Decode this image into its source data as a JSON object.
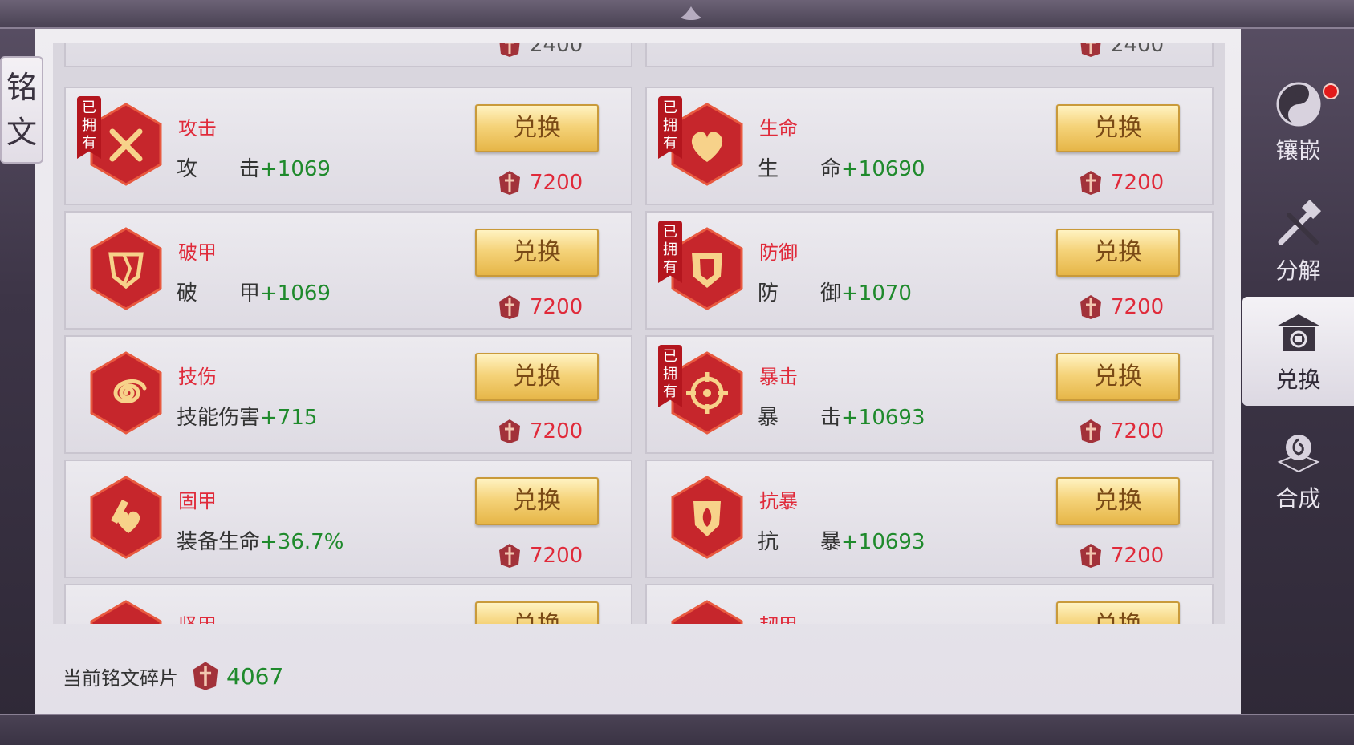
{
  "title": {
    "chars": [
      "铭",
      "文"
    ]
  },
  "top_partial": {
    "left_price": "2400",
    "right_price": "2400"
  },
  "cards": [
    {
      "name": "攻击",
      "stat_label": "攻　　击",
      "stat_value": "+1069",
      "owned": true,
      "button": "兑换",
      "price": "7200",
      "icon": "crossed-swords-icon"
    },
    {
      "name": "生命",
      "stat_label": "生　　命",
      "stat_value": "+10690",
      "owned": true,
      "button": "兑换",
      "price": "7200",
      "icon": "heart-emblem-icon"
    },
    {
      "name": "破甲",
      "stat_label": "破　　甲",
      "stat_value": "+1069",
      "owned": false,
      "button": "兑换",
      "price": "7200",
      "icon": "broken-shield-icon"
    },
    {
      "name": "防御",
      "stat_label": "防　　御",
      "stat_value": "+1070",
      "owned": true,
      "button": "兑换",
      "price": "7200",
      "icon": "shield-icon"
    },
    {
      "name": "技伤",
      "stat_label": "技能伤害",
      "stat_value": "+715",
      "owned": false,
      "button": "兑换",
      "price": "7200",
      "icon": "spiral-icon"
    },
    {
      "name": "暴击",
      "stat_label": "暴　　击",
      "stat_value": "+10693",
      "owned": true,
      "button": "兑换",
      "price": "7200",
      "icon": "crosshair-icon"
    },
    {
      "name": "固甲",
      "stat_label": "装备生命",
      "stat_value": "+36.7%",
      "owned": false,
      "button": "兑换",
      "price": "7200",
      "icon": "armor-heart-icon"
    },
    {
      "name": "抗暴",
      "stat_label": "抗　　暴",
      "stat_value": "+10693",
      "owned": false,
      "button": "兑换",
      "price": "7200",
      "icon": "guard-shield-icon"
    }
  ],
  "bottom_partial": {
    "left_name": "坚甲",
    "right_name": "韧甲",
    "button": "兑换"
  },
  "owned_label": [
    "已",
    "拥",
    "有"
  ],
  "footer": {
    "label": "当前铭文碎片",
    "value": "4067"
  },
  "side_nav": [
    {
      "label": "镶嵌",
      "icon": "yin-yang-icon",
      "active": false,
      "notify": true
    },
    {
      "label": "分解",
      "icon": "hammer-sword-icon",
      "active": false,
      "notify": false
    },
    {
      "label": "兑换",
      "icon": "exchange-shop-icon",
      "active": true,
      "notify": false
    },
    {
      "label": "合成",
      "icon": "synthesis-stone-icon",
      "active": false,
      "notify": false
    }
  ],
  "colors": {
    "name_red": "#e02a3a",
    "value_green": "#1f8a2c",
    "badge_red": "#c6262c",
    "button_gold": "#f5d37a"
  }
}
